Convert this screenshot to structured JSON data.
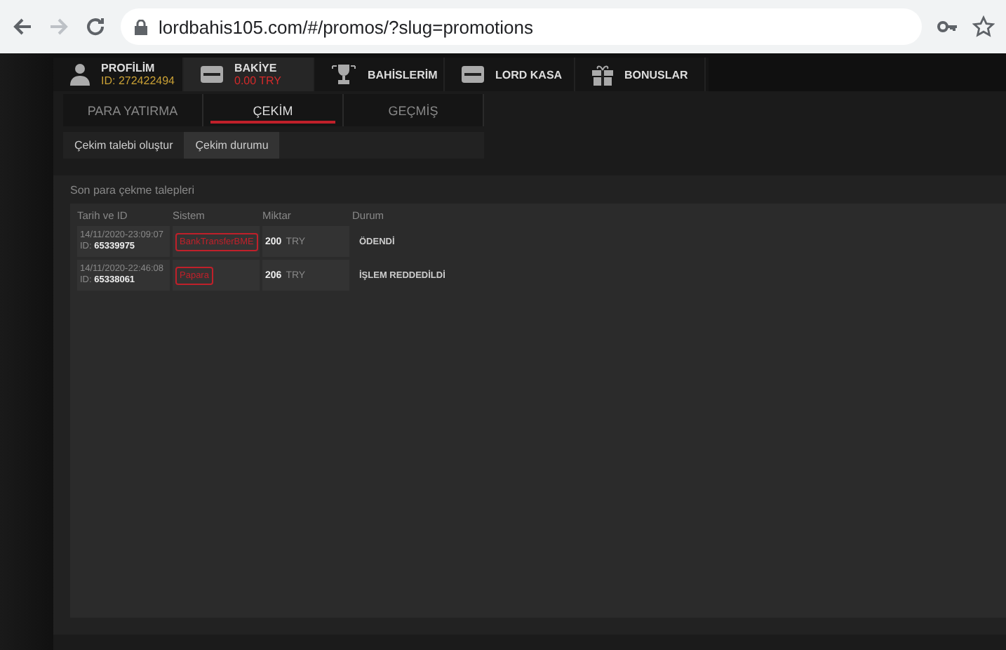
{
  "browser": {
    "url": "lordbahis105.com/#/promos/?slug=promotions"
  },
  "nav": [
    {
      "kind": "profile",
      "label": "PROFİLİM",
      "sub": "ID: 272422494",
      "selected": false
    },
    {
      "kind": "wallet",
      "label": "BAKİYE",
      "sub": "0.00 TRY",
      "selected": true
    },
    {
      "kind": "trophy",
      "label": "BAHİSLERİM",
      "selected": false
    },
    {
      "kind": "wallet",
      "label": "LORD KASA",
      "selected": false
    },
    {
      "kind": "gift",
      "label": "BONUSLAR",
      "selected": false
    }
  ],
  "tabs": [
    {
      "label": "PARA YATIRMA",
      "selected": false
    },
    {
      "label": "ÇEKİM",
      "selected": true
    },
    {
      "label": "GEÇMİŞ",
      "selected": false
    }
  ],
  "subtabs": [
    {
      "label": "Çekim talebi oluştur",
      "selected": false
    },
    {
      "label": "Çekim durumu",
      "selected": true
    }
  ],
  "section": {
    "title": "Son para çekme talepleri",
    "columns": [
      "Tarih ve ID",
      "Sistem",
      "Miktar",
      "Durum"
    ],
    "rows": [
      {
        "date": "14/11/2020-23:09:07",
        "id_label": "ID:",
        "id": "65339975",
        "system": "BankTransferBME",
        "amount": "200",
        "currency": "TRY",
        "status": "ÖDENDİ"
      },
      {
        "date": "14/11/2020-22:46:08",
        "id_label": "ID:",
        "id": "65338061",
        "system": "Papara",
        "amount": "206",
        "currency": "TRY",
        "status": "İŞLEM REDDEDİLDİ"
      }
    ]
  }
}
